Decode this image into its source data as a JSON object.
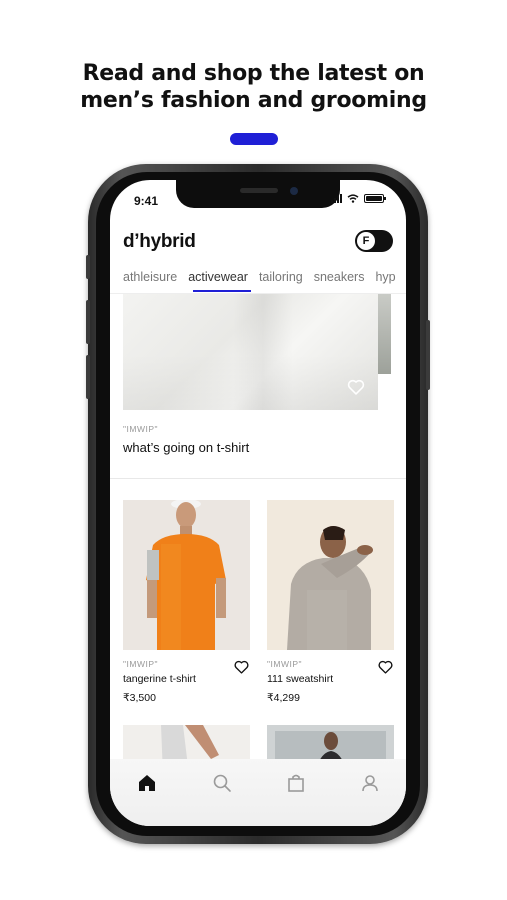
{
  "headline": {
    "line1": "Read and shop the latest on",
    "line2": "men’s fashion and grooming"
  },
  "status_bar": {
    "time": "9:41"
  },
  "app": {
    "brand": "d’hybrid",
    "toggle_label": "F"
  },
  "tabs": [
    {
      "label": "athleisure",
      "active": false
    },
    {
      "label": "activewear",
      "active": true
    },
    {
      "label": "tailoring",
      "active": false
    },
    {
      "label": "sneakers",
      "active": false
    },
    {
      "label": "hyp",
      "active": false
    }
  ],
  "featured": {
    "brand_tag": "\"IMWIP\"",
    "title": "what’s going on t-shirt"
  },
  "products": [
    {
      "brand_tag": "\"IMWIP\"",
      "name": "tangerine t-shirt",
      "price": "₹3,500"
    },
    {
      "brand_tag": "\"IMWIP\"",
      "name": "111 sweatshirt",
      "price": "₹4,299"
    }
  ],
  "bottom_nav": [
    {
      "icon": "home-icon",
      "active": true
    },
    {
      "icon": "search-icon",
      "active": false
    },
    {
      "icon": "bag-icon",
      "active": false
    },
    {
      "icon": "profile-icon",
      "active": false
    }
  ],
  "colors": {
    "accent": "#1f1fd6",
    "text": "#111111",
    "muted": "#999999"
  }
}
